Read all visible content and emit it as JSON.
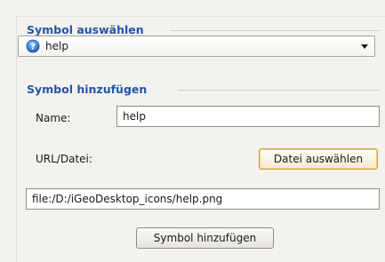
{
  "select_symbol": {
    "title": "Symbol auswählen",
    "selected": {
      "label": "help",
      "icon": "help-icon"
    }
  },
  "add_symbol": {
    "title": "Symbol hinzufügen",
    "name_label": "Name:",
    "name_value": "help",
    "url_label": "URL/Datei:",
    "choose_file_button": "Datei auswählen",
    "path_value": "file:/D:/iGeoDesktop_icons/help.png",
    "add_button": "Symbol hinzufügen"
  },
  "colors": {
    "section_title": "#2255a8",
    "background": "#f3f2ee",
    "focus_border": "#d39a3e"
  }
}
